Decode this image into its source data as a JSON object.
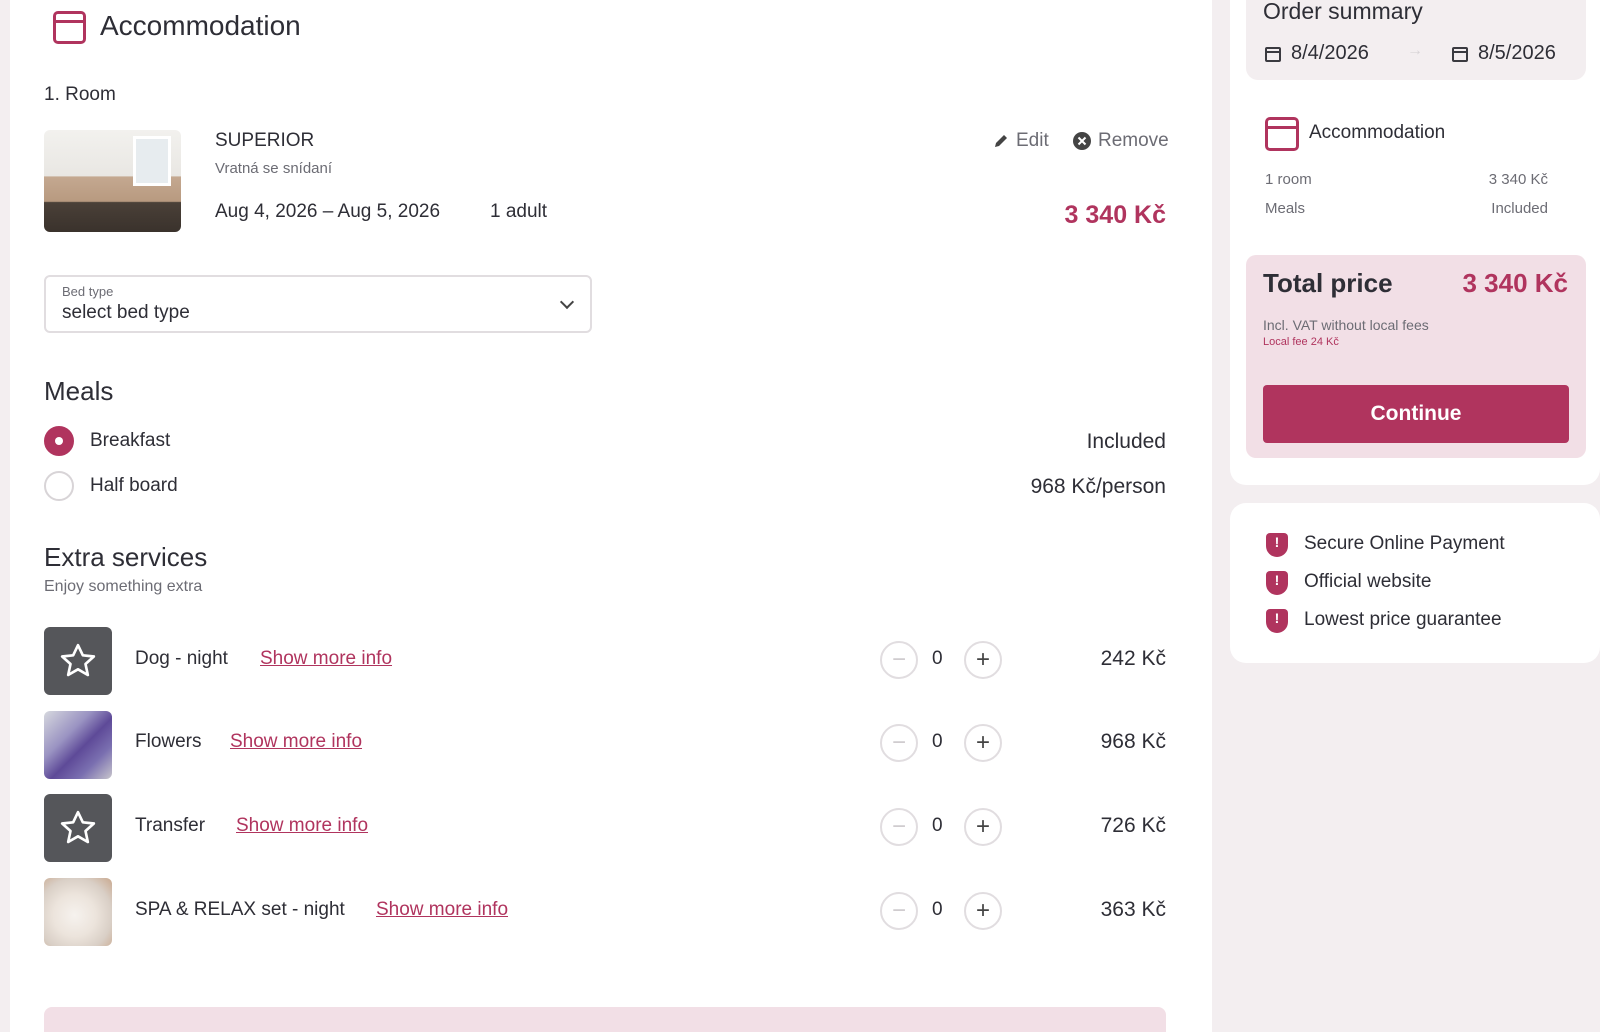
{
  "accommodation": {
    "title": "Accommodation",
    "room_heading": "1. Room",
    "room": {
      "name": "SUPERIOR",
      "rate": "Vratná se snídaní",
      "dates": "Aug 4, 2026 – Aug 5, 2026",
      "guests": "1 adult",
      "price": "3 340 Kč",
      "edit_label": "Edit",
      "remove_label": "Remove"
    },
    "bed_type": {
      "label": "Bed type",
      "value": "select bed type"
    }
  },
  "meals": {
    "title": "Meals",
    "options": [
      {
        "label": "Breakfast",
        "price": "Included",
        "selected": true
      },
      {
        "label": "Half board",
        "price": "968 Kč/person",
        "selected": false
      }
    ]
  },
  "extras": {
    "title": "Extra services",
    "subtitle": "Enjoy something extra",
    "link_label": "Show more info",
    "items": [
      {
        "name": "Dog - night",
        "quantity": "0",
        "price": "242 Kč",
        "thumb": "star-icon"
      },
      {
        "name": "Flowers",
        "quantity": "0",
        "price": "968 Kč",
        "thumb": "flowers-photo"
      },
      {
        "name": "Transfer",
        "quantity": "0",
        "price": "726 Kč",
        "thumb": "star-icon"
      },
      {
        "name": "SPA & RELAX set - night",
        "quantity": "0",
        "price": "363 Kč",
        "thumb": "spa-photo"
      }
    ]
  },
  "summary": {
    "title": "Order summary",
    "date_from": "8/4/2026",
    "date_to": "8/5/2026",
    "accommodation_title": "Accommodation",
    "rows": [
      {
        "label": "1 room",
        "value": "3 340 Kč"
      },
      {
        "label": "Meals",
        "value": "Included"
      }
    ],
    "total_label": "Total price",
    "total_value": "3 340 Kč",
    "vat_note": "Incl. VAT without local fees",
    "local_fee": "Local fee 24 Kč",
    "continue_label": "Continue"
  },
  "trust": {
    "items": [
      "Secure Online Payment",
      "Official website",
      "Lowest price guarantee"
    ]
  },
  "colors": {
    "accent": "#b0345e",
    "accent_light": "#f2dfe6",
    "background": "#f3eef0"
  }
}
